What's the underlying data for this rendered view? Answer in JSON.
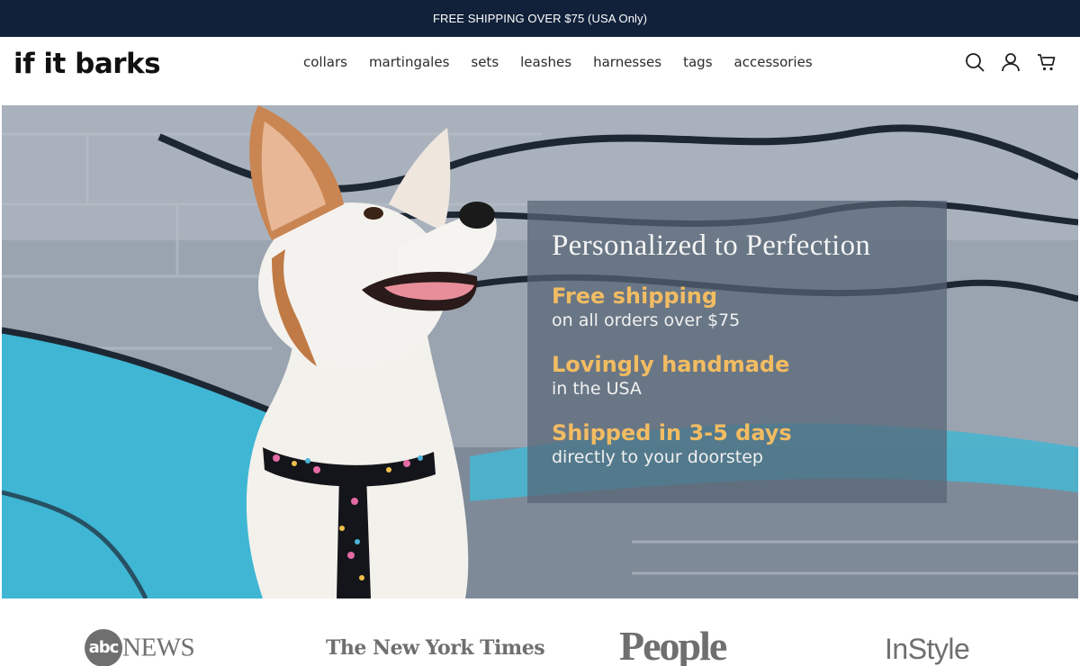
{
  "announcement": {
    "text": "FREE SHIPPING OVER $75 (USA Only)"
  },
  "header": {
    "logo": "if it barks",
    "nav": [
      "collars",
      "martingales",
      "sets",
      "leashes",
      "harnesses",
      "tags",
      "accessories"
    ],
    "icons": [
      "search-icon",
      "account-icon",
      "cart-icon"
    ]
  },
  "hero": {
    "title": "Personalized to Perfection",
    "features": [
      {
        "heading": "Free shipping",
        "sub": "on all orders over $75"
      },
      {
        "heading": "Lovingly handmade",
        "sub": "in the USA"
      },
      {
        "heading": "Shipped in 3-5 days",
        "sub": "directly to your doorstep"
      }
    ],
    "accent_color": "#f2bc62"
  },
  "press": {
    "abc_mark": "abc",
    "abc_news": "NEWS",
    "nyt": "The New York Times",
    "people": "People",
    "instyle": "InStyle"
  }
}
